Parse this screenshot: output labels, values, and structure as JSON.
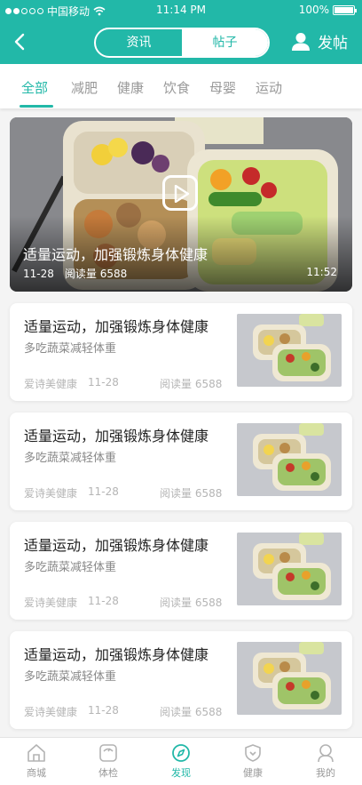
{
  "status_bar": {
    "carrier": "中国移动",
    "time": "11:14 PM",
    "battery": "100%"
  },
  "header": {
    "segments": [
      "资讯",
      "帖子"
    ],
    "active_segment": "帖子",
    "post_button": "发帖"
  },
  "tabs": {
    "items": [
      "全部",
      "减肥",
      "健康",
      "饮食",
      "母婴",
      "运动"
    ],
    "active": "全部"
  },
  "featured": {
    "title": "适量运动，加强锻炼身体健康",
    "date": "11-28",
    "reads": "阅读量 6588",
    "duration": "11:52"
  },
  "articles": [
    {
      "title": "适量运动，加强锻炼身体健康",
      "subtitle": "多吃蔬菜减轻体重",
      "author": "爱诗美健康",
      "date": "11-28",
      "reads": "阅读量 6588"
    },
    {
      "title": "适量运动，加强锻炼身体健康",
      "subtitle": "多吃蔬菜减轻体重",
      "author": "爱诗美健康",
      "date": "11-28",
      "reads": "阅读量 6588"
    },
    {
      "title": "适量运动，加强锻炼身体健康",
      "subtitle": "多吃蔬菜减轻体重",
      "author": "爱诗美健康",
      "date": "11-28",
      "reads": "阅读量 6588"
    },
    {
      "title": "适量运动，加强锻炼身体健康",
      "subtitle": "多吃蔬菜减轻体重",
      "author": "爱诗美健康",
      "date": "11-28",
      "reads": "阅读量 6588"
    }
  ],
  "bottom_nav": {
    "items": [
      {
        "label": "商城",
        "icon": "home-icon"
      },
      {
        "label": "体检",
        "icon": "scale-icon"
      },
      {
        "label": "发现",
        "icon": "compass-icon"
      },
      {
        "label": "健康",
        "icon": "shield-icon"
      },
      {
        "label": "我的",
        "icon": "profile-icon"
      }
    ],
    "active": "发现"
  },
  "colors": {
    "accent": "#22b8a8",
    "muted_text": "#999999",
    "title_text": "#222222"
  }
}
